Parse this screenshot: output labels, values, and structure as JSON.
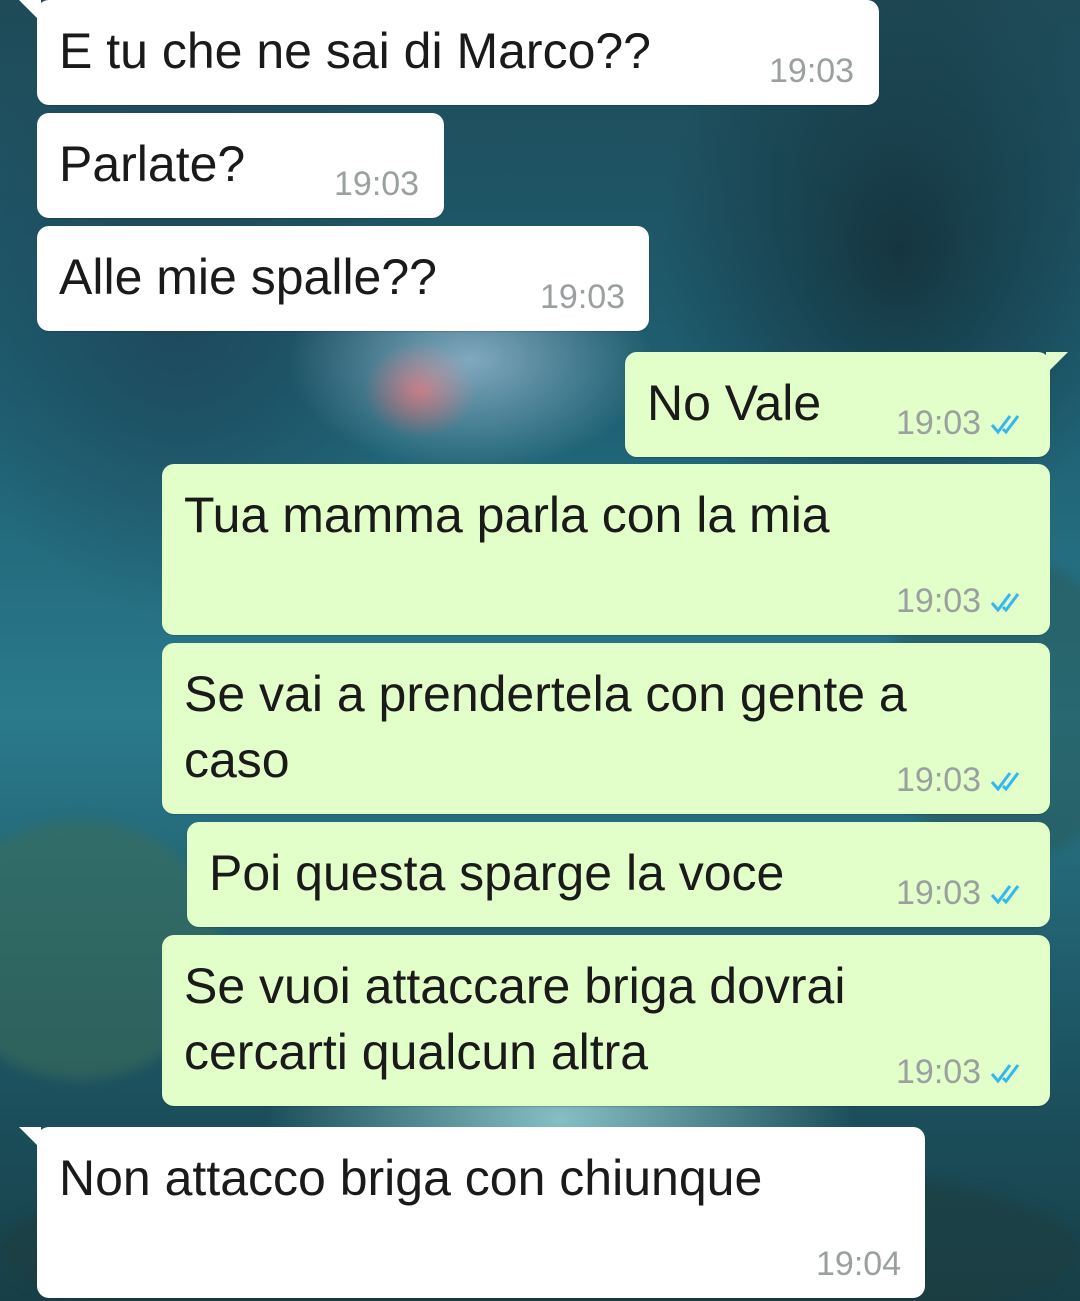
{
  "messages": [
    {
      "direction": "incoming",
      "lines": [
        "E tu che ne sai di Marco??"
      ],
      "time": "19:03"
    },
    {
      "direction": "incoming",
      "lines": [
        "Parlate?"
      ],
      "time": "19:03"
    },
    {
      "direction": "incoming",
      "lines": [
        "Alle mie spalle??"
      ],
      "time": "19:03"
    },
    {
      "direction": "outgoing",
      "lines": [
        "No Vale"
      ],
      "time": "19:03",
      "status": "read"
    },
    {
      "direction": "outgoing",
      "lines": [
        "Tua mamma parla con la mia"
      ],
      "time": "19:03",
      "status": "read"
    },
    {
      "direction": "outgoing",
      "lines": [
        "Se vai a prendertela con gente a",
        "caso"
      ],
      "time": "19:03",
      "status": "read"
    },
    {
      "direction": "outgoing",
      "lines": [
        "Poi questa sparge la voce"
      ],
      "time": "19:03",
      "status": "read"
    },
    {
      "direction": "outgoing",
      "lines": [
        "Se vuoi attaccare briga dovrai",
        "cercarti qualcun altra"
      ],
      "time": "19:03",
      "status": "read"
    },
    {
      "direction": "incoming",
      "lines": [
        "Non attacco briga con chiunque"
      ],
      "time": "19:04"
    }
  ],
  "icons": {
    "read_receipt": "double-check-icon"
  },
  "colors": {
    "incoming_bubble": "#ffffff",
    "outgoing_bubble": "#e2fec9",
    "read_tick": "#34b7f1",
    "timestamp": "#9aa0a0"
  }
}
